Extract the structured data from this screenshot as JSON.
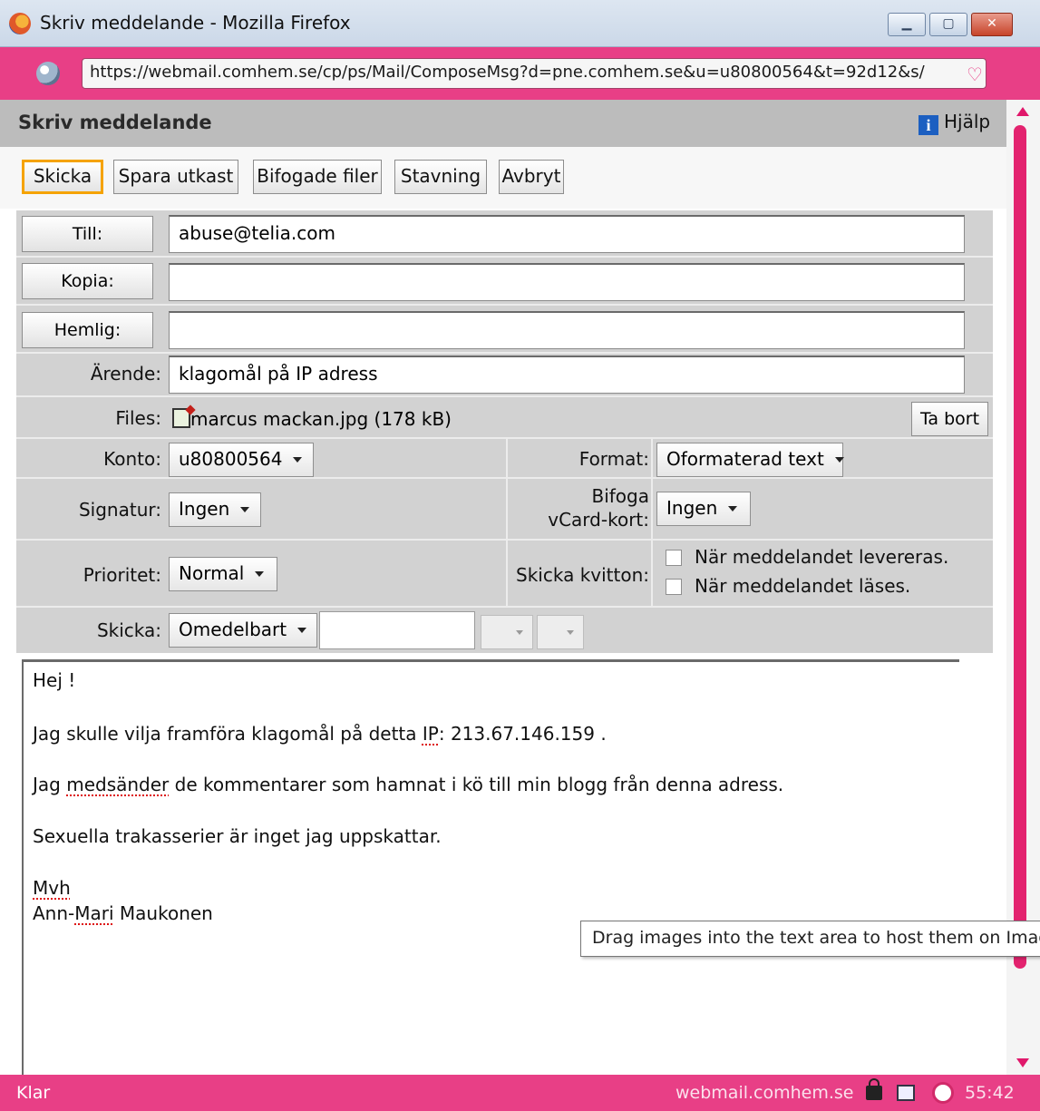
{
  "window": {
    "title": "Skriv meddelande - Mozilla Firefox",
    "url": "https://webmail.comhem.se/cp/ps/Mail/ComposeMsg?d=pne.comhem.se&u=u80800564&t=92d12&s/"
  },
  "heading": {
    "title": "Skriv meddelande",
    "help": "Hjälp"
  },
  "toolbar": {
    "send": "Skicka",
    "save_draft": "Spara utkast",
    "attachments": "Bifogade filer",
    "spelling": "Stavning",
    "cancel": "Avbryt"
  },
  "recipients": {
    "to_label": "Till:",
    "to_value": "abuse@telia.com",
    "cc_label": "Kopia:",
    "cc_value": "",
    "bcc_label": "Hemlig:",
    "bcc_value": ""
  },
  "subject": {
    "label": "Ärende:",
    "value": "klagomål på IP adress"
  },
  "files": {
    "label": "Files:",
    "file": "marcus mackan.jpg (178 kB)",
    "remove": "Ta bort"
  },
  "options": {
    "account_label": "Konto:",
    "account_value": "u80800564",
    "format_label": "Format:",
    "format_value": "Oformaterad text",
    "signature_label": "Signatur:",
    "signature_value": "Ingen",
    "vcard_label_1": "Bifoga",
    "vcard_label_2": "vCard-kort:",
    "vcard_value": "Ingen",
    "priority_label": "Prioritet:",
    "priority_value": "Normal",
    "receipt_label": "Skicka kvitton:",
    "receipt_delivered": "När meddelandet levereras.",
    "receipt_read": "När meddelandet läses.",
    "send_label": "Skicka:",
    "send_value": "Omedelbart"
  },
  "message": {
    "greeting": "Hej !",
    "line1_a": "Jag skulle vilja framföra klagomål på detta ",
    "line1_b": "IP",
    "line1_c": ": 213.67.146.159 .",
    "line2_a": "Jag ",
    "line2_b": "medsänder",
    "line2_c": " de kommentarer som hamnat i kö till min blogg från denna adress.",
    "line3": "Sexuella trakasserier är inget jag uppskattar.",
    "signoff": "Mvh",
    "name_a": "Ann-",
    "name_b": "Mari",
    "name_c": " Maukonen"
  },
  "tooltip": "Drag images into the text area to host them on Image",
  "status": {
    "left": "Klar",
    "domain": "webmail.comhem.se",
    "time": "55:42"
  },
  "icons": {
    "app": "firefox-icon",
    "site": "globe-icon",
    "help": "info-icon",
    "file": "file-icon",
    "lock": "lock-icon",
    "edit": "edit-icon",
    "clock": "clock-icon"
  },
  "colors": {
    "accent": "#e83f86",
    "send_highlight": "#f5a300",
    "help_icon": "#1c5fc1"
  }
}
